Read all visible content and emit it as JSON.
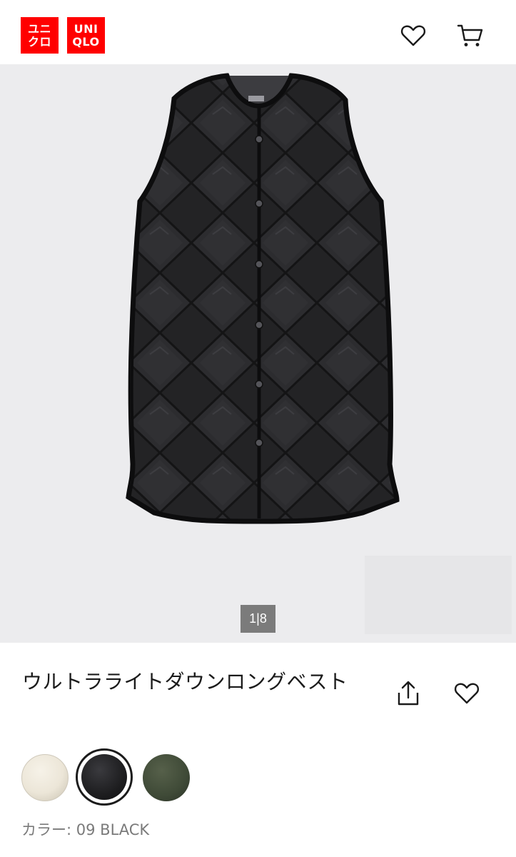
{
  "header": {
    "logo_left": [
      "ユニ",
      "クロ"
    ],
    "logo_right": [
      "UNI",
      "QLO"
    ],
    "favorites_icon": "heart-icon",
    "cart_icon": "cart-icon"
  },
  "gallery": {
    "current_index": 1,
    "total": 8,
    "pager_text": "1|8"
  },
  "product": {
    "name": "ウルトラライトダウンロングベスト",
    "share_icon": "share-icon",
    "favorite_icon": "heart-icon"
  },
  "colors": {
    "swatches": [
      {
        "name": "off-white",
        "hex": "#ece6d8",
        "selected": false
      },
      {
        "name": "black",
        "hex": "#1e1e20",
        "selected": true
      },
      {
        "name": "olive",
        "hex": "#3f4a37",
        "selected": false
      }
    ],
    "label_prefix": "カラー:",
    "label_value": "09 BLACK"
  },
  "brand_color": "#ff0000"
}
